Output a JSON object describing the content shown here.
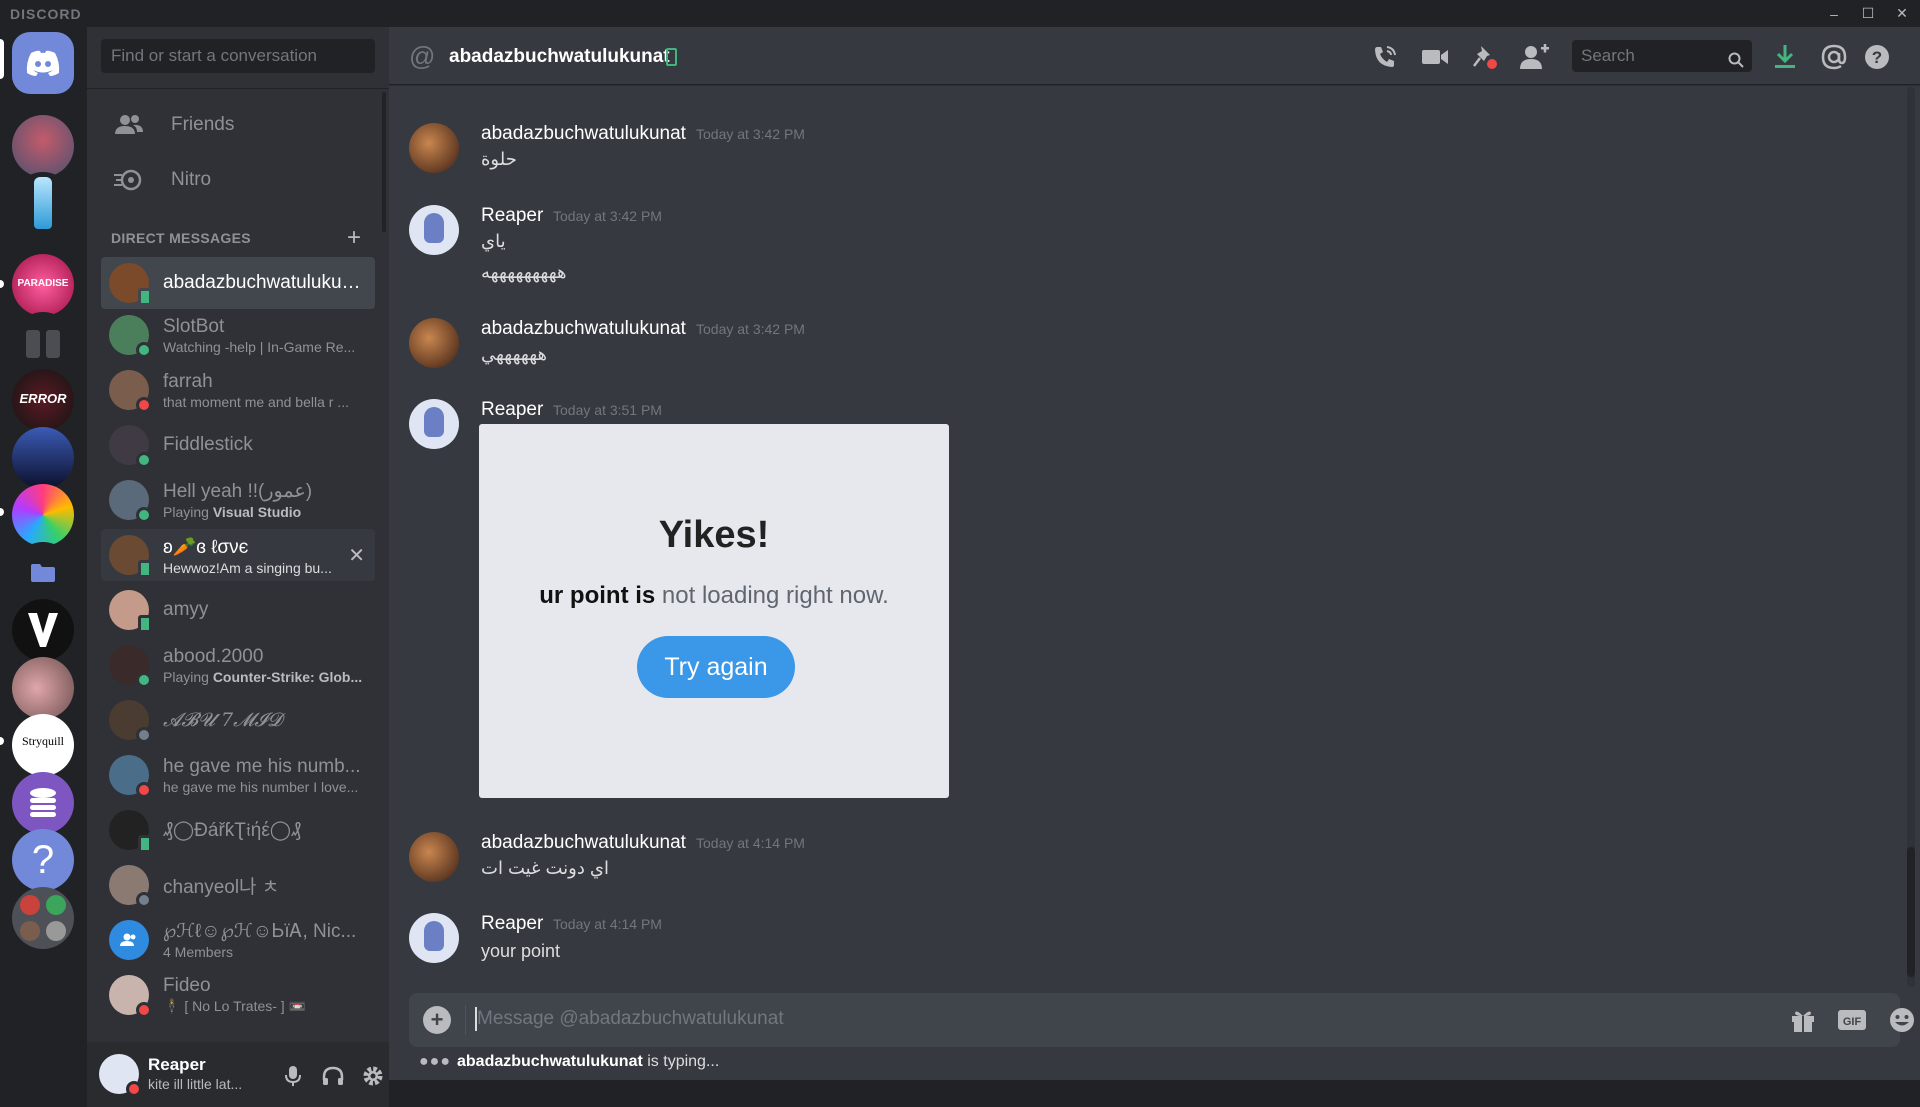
{
  "app": {
    "title": "DISCORD",
    "window_controls": [
      "–",
      "☐",
      "✕"
    ]
  },
  "guilds": [
    {
      "name": "home",
      "icon": "discord-logo-icon",
      "color": "#7289da"
    },
    {
      "name": "server-2",
      "color": "#6b5a7a"
    },
    {
      "name": "server-3",
      "color": "#2e9ad6"
    },
    {
      "name": "server-4",
      "color": "#d8185a"
    },
    {
      "name": "server-5",
      "color": "#4a4d52"
    },
    {
      "name": "server-6",
      "color": "#3b1014"
    },
    {
      "name": "server-7",
      "color": "#25306e"
    },
    {
      "name": "server-8",
      "color": "#b32891"
    },
    {
      "name": "folder",
      "icon": "folder-icon",
      "color": "#7289da"
    },
    {
      "name": "server-10",
      "color": "#111111"
    },
    {
      "name": "server-11",
      "color": "#b07a86"
    },
    {
      "name": "server-12",
      "color": "#ffffff"
    },
    {
      "name": "server-13",
      "color": "#7e56c2"
    },
    {
      "name": "help",
      "color": "#7289da"
    },
    {
      "name": "server-15",
      "color": "#4e5058"
    }
  ],
  "sidebar": {
    "search_placeholder": "Find or start a conversation",
    "nav": [
      {
        "label": "Friends",
        "icon": "friends-icon"
      },
      {
        "label": "Nitro",
        "icon": "nitro-icon"
      }
    ],
    "dm_header": "DIRECT MESSAGES",
    "dms": [
      {
        "name": "abadazbuchwatulukunat",
        "sub": "",
        "color": "#7a4a2a",
        "status": "mobile",
        "state": "selected"
      },
      {
        "name": "SlotBot",
        "sub": "Watching -help | In-Game Re...",
        "color": "#4b7f5c",
        "status": "online"
      },
      {
        "name": "farrah",
        "sub": "that moment me and bella r ...",
        "color": "#7b5d4d",
        "status": "dnd"
      },
      {
        "name": "Fiddlestick",
        "sub": "",
        "color": "#3f3a44",
        "status": "online"
      },
      {
        "name": "Hell yeah !!(عمور)",
        "sub_prefix": "Playing ",
        "sub_bold": "Visual Studio",
        "sub": "",
        "color": "#5a6a7a",
        "status": "online"
      },
      {
        "name": "ʚ🥕ɞ ℓσνє",
        "sub": "Hewwoz!Am a singing bu...",
        "color": "#6b4a33",
        "status": "mobile",
        "state": "hover"
      },
      {
        "name": "amyy",
        "sub": "",
        "color": "#c49a8a",
        "status": "mobile"
      },
      {
        "name": "abood.2000",
        "sub_prefix": "Playing ",
        "sub_bold": "Counter-Strike: Glob...",
        "sub": "",
        "color": "#3a2a2a",
        "status": "online"
      },
      {
        "name": "𝓐𝓑𝓤 7𝓜𝓘𝓓",
        "sub": "",
        "color": "#4a3c30",
        "status": "offline"
      },
      {
        "name": "he gave me his numb...",
        "sub": "he gave me his number I love...",
        "color": "#4a6e8a",
        "status": "dnd"
      },
      {
        "name": "₰◯ĐářƙƮ𝔦ήέ◯₰",
        "sub": "",
        "color": "#222222",
        "status": "mobile"
      },
      {
        "name": "chanyeol나 ㅊ",
        "sub": "",
        "color": "#8a7a72",
        "status": "offline"
      },
      {
        "name": "℘ℋℓ☺℘ℋ☺ᏏïᎪ, Nic...",
        "sub": "4 Members",
        "color": "#2e8be0",
        "status": ""
      },
      {
        "name": "Fideo",
        "sub": "🕴 [ No Lo Trates- ] 📼",
        "color": "#c9b3ad",
        "status": ""
      }
    ],
    "user": {
      "name": "Reaper",
      "status": "kite ill little lat..."
    }
  },
  "chat": {
    "channel": "abadazbuchwatulukunat",
    "search_placeholder": "Search",
    "messages": [
      {
        "author": "abadazbuchwatulukunat",
        "time": "Today at 3:42 PM",
        "lines": [
          "حلوة"
        ],
        "color": "#6b3c22"
      },
      {
        "author": "Reaper",
        "time": "Today at 3:42 PM",
        "lines": [
          "ياي",
          "هههههههههه"
        ],
        "color": "#dfe5f3"
      },
      {
        "author": "abadazbuchwatulukunat",
        "time": "Today at 3:42 PM",
        "lines": [
          "ههههههي"
        ],
        "color": "#6b3c22"
      },
      {
        "author": "Reaper",
        "time": "Today at 3:51 PM",
        "lines": [],
        "color": "#dfe5f3"
      },
      {
        "author": "abadazbuchwatulukunat",
        "time": "Today at 4:14 PM",
        "lines": [
          "اي دونت غيت ات"
        ],
        "color": "#6b3c22"
      },
      {
        "author": "Reaper",
        "time": "Today at 4:14 PM",
        "lines": [
          "your point"
        ],
        "color": "#dfe5f3"
      }
    ],
    "embed": {
      "title": "Yikes!",
      "sub_bold": "ur point is",
      "sub_rest": " not loading right now.",
      "button": "Try again"
    },
    "composer_placeholder": "Message @abadazbuchwatulukunat",
    "typing_user": "abadazbuchwatulukunat",
    "typing_suffix": " is typing..."
  },
  "colors": {
    "accent": "#7289da",
    "online": "#43b581",
    "dnd": "#f04747",
    "link_button": "#3b97e8"
  }
}
